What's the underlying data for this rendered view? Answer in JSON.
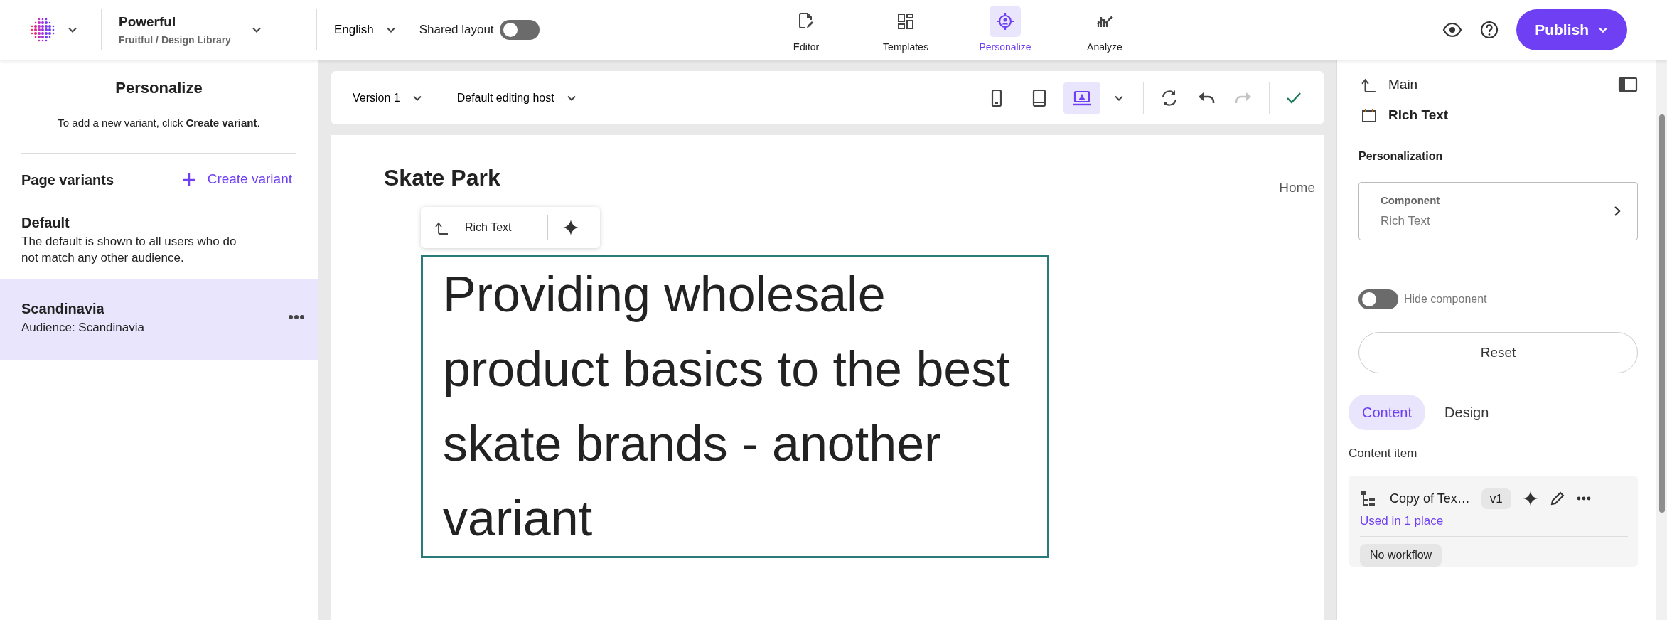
{
  "topbar": {
    "site": {
      "name": "Powerful",
      "path": "Fruitful / Design Library"
    },
    "language": "English",
    "shared_layout": {
      "label": "Shared layout",
      "on": false
    },
    "nav_tabs": [
      {
        "kind": "editor",
        "label": "Editor",
        "selected": false
      },
      {
        "kind": "templates",
        "label": "Templates",
        "selected": false
      },
      {
        "kind": "personalize",
        "label": "Personalize",
        "selected": true
      },
      {
        "kind": "analyze",
        "label": "Analyze",
        "selected": false
      }
    ],
    "publish": "Publish"
  },
  "left_panel": {
    "title": "Personalize",
    "hint": "To add a new variant, click **Create variant**.",
    "section_title": "Page variants",
    "create_label": "Create variant",
    "variants": [
      {
        "name": "Default",
        "description": "The default is shown to all users who do not match any other audience.",
        "selected": false
      },
      {
        "name": "Scandinavia",
        "description": "Audience: Scandinavia",
        "selected": true
      }
    ]
  },
  "canvas_toolbar": {
    "version": "Version 1",
    "host": "Default editing host",
    "devices": [
      {
        "kind": "phone",
        "selected": false
      },
      {
        "kind": "tablet",
        "selected": false
      },
      {
        "kind": "laptop",
        "selected": true
      }
    ],
    "actions": [
      {
        "kind": "refresh",
        "disabled": false
      },
      {
        "kind": "undo",
        "disabled": false
      },
      {
        "kind": "redo",
        "disabled": true
      }
    ]
  },
  "page": {
    "site_title": "Skate Park",
    "nav_link": "Home",
    "chip_label": "Rich Text",
    "heading": "Providing wholesale product basics to the best skate brands - another variant"
  },
  "right_panel": {
    "parent": "Main",
    "component": "Rich Text",
    "section": "Personalization",
    "card_label": "Component",
    "card_value": "Rich Text",
    "hide_toggle": {
      "label": "Hide component",
      "on": false
    },
    "reset": "Reset",
    "tabs": [
      {
        "label": "Content",
        "selected": true
      },
      {
        "label": "Design",
        "selected": false
      }
    ],
    "content_item_label": "Content item",
    "item": {
      "name": "Copy of Tex…",
      "version": "v1",
      "usage": "Used in 1 place",
      "workflow": "No workflow"
    }
  }
}
